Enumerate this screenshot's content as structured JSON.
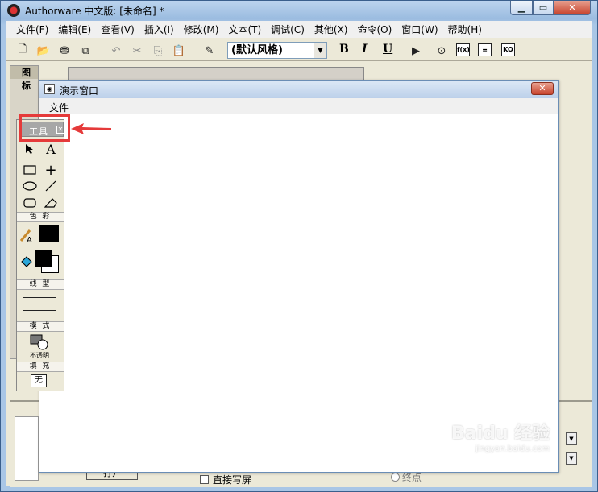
{
  "window": {
    "title": "Authorware 中文版: [未命名] *"
  },
  "menu": [
    "文件(F)",
    "编辑(E)",
    "查看(V)",
    "插入(I)",
    "修改(M)",
    "文本(T)",
    "调试(C)",
    "其他(X)",
    "命令(O)",
    "窗口(W)",
    "帮助(H)"
  ],
  "toolbar": {
    "style_value": "(默认风格)"
  },
  "icons_panel": {
    "title": "图标"
  },
  "presentation": {
    "title": "演示窗口",
    "menu_file": "文件"
  },
  "tools": {
    "title": "工具",
    "color_label": "色 彩",
    "line_label": "线 型",
    "mode_label": "模 式",
    "mode_value": "不透明",
    "fill_label": "填 充",
    "fill_value": "无"
  },
  "props": {
    "open_button": "打开",
    "direct_write": "直接写屏",
    "end_point": "终点"
  },
  "watermark": {
    "text": "Baidu 经验",
    "sub": "jingyan.baidu.com"
  },
  "colors": {
    "highlight": "#e53a3a",
    "titlebar": "#bcd4ee"
  }
}
